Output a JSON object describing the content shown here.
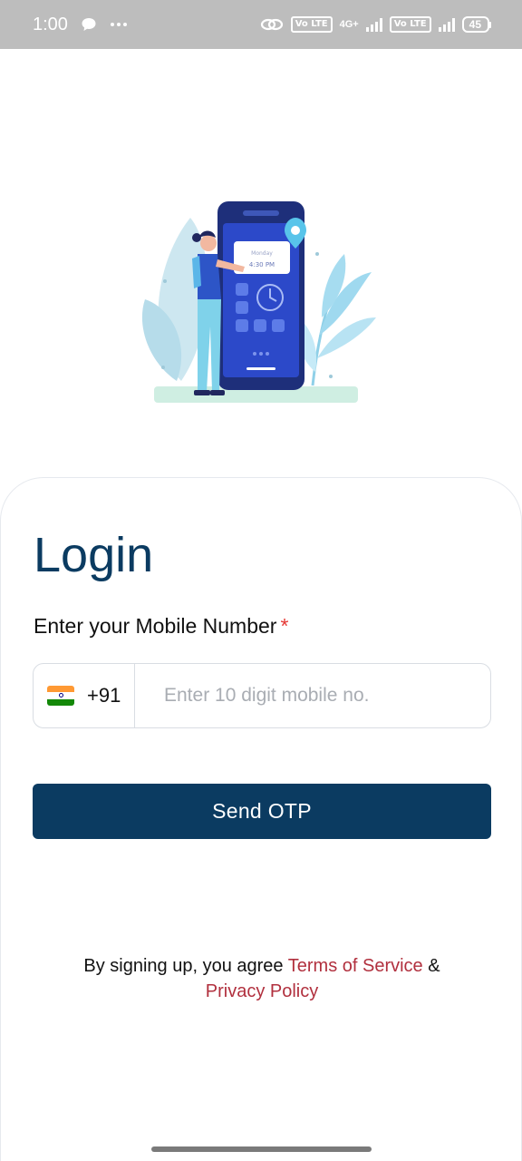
{
  "status_bar": {
    "time": "1:00",
    "net_label_1": "Vo LTE",
    "net_type": "4G+",
    "net_label_2": "Vo LTE",
    "battery": "45",
    "icons": [
      "chat-bubble-icon",
      "more-dots-icon",
      "link-icon",
      "volte-icon",
      "signal-icon",
      "battery-icon"
    ]
  },
  "illustration": {
    "phone_day": "Monday",
    "phone_time": "4:30 PM"
  },
  "login": {
    "title": "Login",
    "mobile_label": "Enter your Mobile Number",
    "required_mark": "*",
    "country_code": "+91",
    "mobile_placeholder": "Enter 10 digit mobile no.",
    "mobile_value": "",
    "send_otp_label": "Send OTP"
  },
  "terms": {
    "prefix": "By signing up, you agree ",
    "terms_link": "Terms of Service",
    "ampersand": " &",
    "privacy_link": "Privacy Policy"
  },
  "colors": {
    "primary": "#0b3b61",
    "link": "#b1303e",
    "required": "#e53935",
    "status_bar": "#bdbdbd"
  }
}
